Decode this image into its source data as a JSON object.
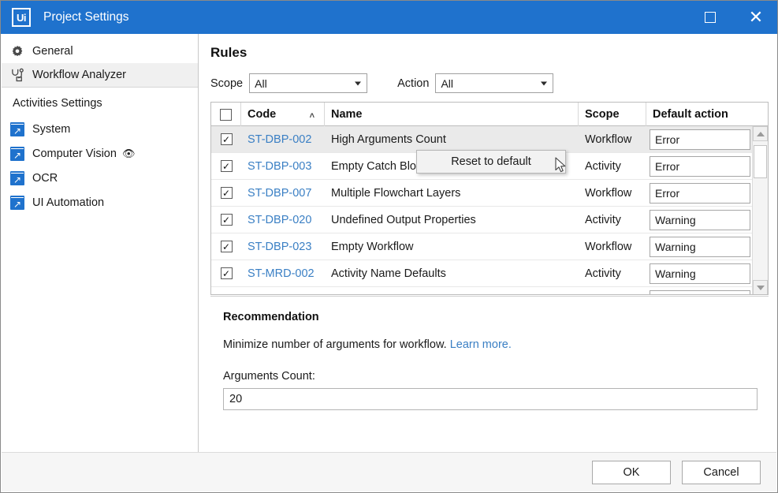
{
  "window": {
    "logo": "Ui",
    "title": "Project Settings",
    "maximize_icon": "maximize-icon",
    "close_icon": "close-icon"
  },
  "sidebar": {
    "items": [
      {
        "label": "General",
        "icon": "gear-icon",
        "selected": false
      },
      {
        "label": "Workflow Analyzer",
        "icon": "stethoscope-icon",
        "selected": true
      }
    ],
    "section_label": "Activities Settings",
    "activities": [
      {
        "label": "System",
        "icon": "package-icon",
        "badge": ""
      },
      {
        "label": "Computer Vision",
        "icon": "package-icon",
        "badge": "eye-icon"
      },
      {
        "label": "OCR",
        "icon": "package-icon",
        "badge": ""
      },
      {
        "label": "UI Automation",
        "icon": "package-icon",
        "badge": ""
      }
    ]
  },
  "main": {
    "heading": "Rules",
    "filters": {
      "scope_label": "Scope",
      "scope_value": "All",
      "action_label": "Action",
      "action_value": "All"
    },
    "table": {
      "columns": {
        "select_all": "",
        "code": "Code",
        "code_sort": "˄",
        "name": "Name",
        "scope": "Scope",
        "default_action": "Default action"
      },
      "rows": [
        {
          "checked": "✓",
          "code": "ST-DBP-002",
          "name": "High Arguments Count",
          "scope": "Workflow",
          "action": "Error",
          "selected": true
        },
        {
          "checked": "✓",
          "code": "ST-DBP-003",
          "name": "Empty Catch Block",
          "scope": "Activity",
          "action": "Error",
          "selected": false
        },
        {
          "checked": "✓",
          "code": "ST-DBP-007",
          "name": "Multiple Flowchart Layers",
          "scope": "Workflow",
          "action": "Error",
          "selected": false
        },
        {
          "checked": "✓",
          "code": "ST-DBP-020",
          "name": "Undefined Output Properties",
          "scope": "Activity",
          "action": "Warning",
          "selected": false
        },
        {
          "checked": "✓",
          "code": "ST-DBP-023",
          "name": "Empty Workflow",
          "scope": "Workflow",
          "action": "Warning",
          "selected": false
        },
        {
          "checked": "✓",
          "code": "ST-MRD-002",
          "name": "Activity Name Defaults",
          "scope": "Activity",
          "action": "Warning",
          "selected": false
        }
      ]
    },
    "recommendation": {
      "title": "Recommendation",
      "text": "Minimize number of arguments for workflow.",
      "link": "Learn more.",
      "field_label": "Arguments Count:",
      "field_value": "20"
    }
  },
  "context_menu": {
    "item": "Reset to default"
  },
  "footer": {
    "ok": "OK",
    "cancel": "Cancel"
  },
  "colors": {
    "titlebar": "#1f72cd",
    "link": "#3a7fc4",
    "selected_row": "#eaeaea",
    "sidebar_selected": "#f0f0f0"
  }
}
